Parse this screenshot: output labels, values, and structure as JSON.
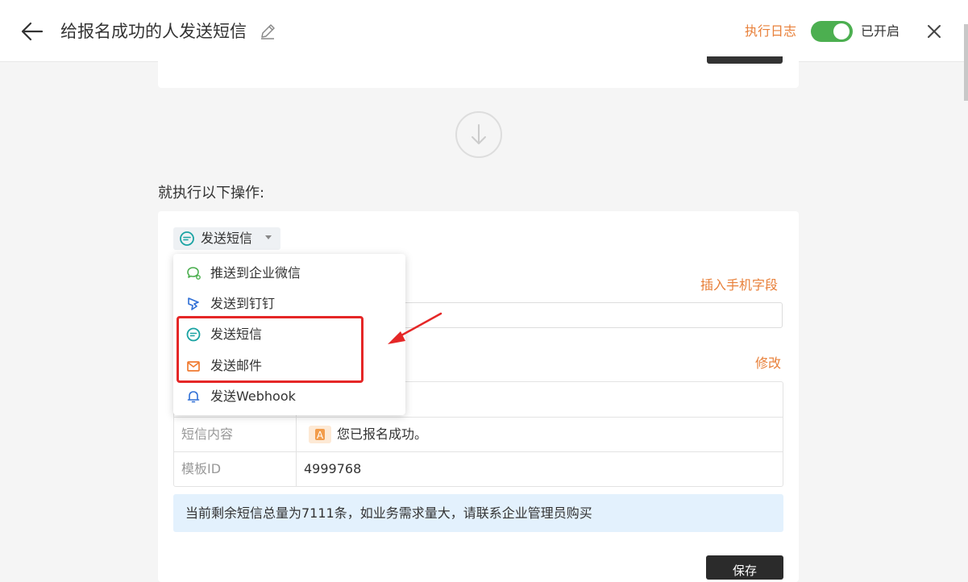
{
  "header": {
    "title": "给报名成功的人发送短信",
    "log_link": "执行日志",
    "toggle_label": "已开启",
    "toggle_on": true,
    "accent_color": "#e8803a",
    "toggle_color": "#4caf50"
  },
  "main": {
    "section_heading": "就执行以下操作:",
    "action_select": {
      "label": "发送短信",
      "icon": "message-icon"
    },
    "insert_field_link": "插入手机字段",
    "modify_link": "修改",
    "table": {
      "rows": [
        {
          "key": "",
          "value": ""
        },
        {
          "key": "短信内容",
          "badge": "A",
          "value": "您已报名成功。"
        },
        {
          "key": "模板ID",
          "value": "4999768"
        }
      ]
    },
    "notice": "当前剩余短信总量为7111条，如业务需求量大，请联系企业管理员购买",
    "save_button": "保存"
  },
  "dropdown": {
    "items": [
      {
        "label": "推送到企业微信",
        "icon": "wechat-work-icon",
        "color": "#4caf50"
      },
      {
        "label": "发送到钉钉",
        "icon": "dingtalk-icon",
        "color": "#2f6fd6"
      },
      {
        "label": "发送短信",
        "icon": "message-icon",
        "color": "#1aa3a3"
      },
      {
        "label": "发送邮件",
        "icon": "mail-icon",
        "color": "#f07a30"
      },
      {
        "label": "发送Webhook",
        "icon": "bell-icon",
        "color": "#2f6fd6"
      }
    ]
  },
  "annotation": {
    "highlight_color": "#e52727"
  }
}
